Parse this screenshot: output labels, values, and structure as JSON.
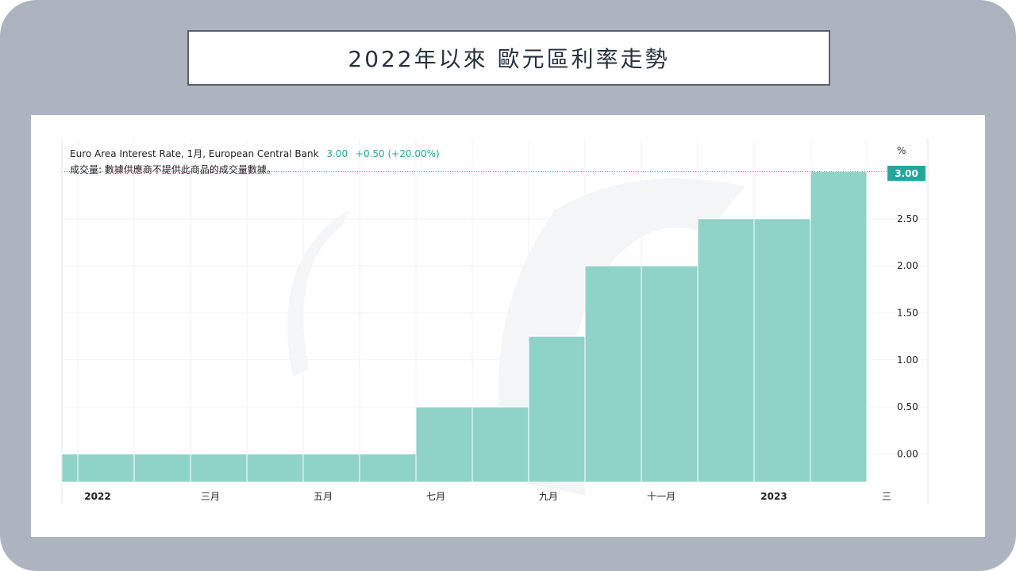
{
  "page": {
    "title": "2022年以來 歐元區利率走勢"
  },
  "legend": {
    "series_label": "Euro Area Interest Rate, 1月, European Central Bank",
    "last_value": "3.00",
    "change": "+0.50 (+20.00%)",
    "volume_note": "成交量: 數據供應商不提供此商品的成交量數據。"
  },
  "colors": {
    "bar_fill": "#8fd3c8",
    "accent": "#26a69a",
    "frame": "#adb4bf"
  },
  "chart_data": {
    "type": "bar",
    "title": "",
    "unit": "%",
    "categories": [
      "2021-12",
      "2022-01",
      "2022-02",
      "2022-03",
      "2022-04",
      "2022-05",
      "2022-06",
      "2022-07",
      "2022-08",
      "2022-09",
      "2022-10",
      "2022-11",
      "2022-12",
      "2023-01",
      "2023-02"
    ],
    "values": [
      0.0,
      0.0,
      0.0,
      0.0,
      0.0,
      0.0,
      0.0,
      0.5,
      0.5,
      1.25,
      2.0,
      2.0,
      2.5,
      2.5,
      3.0
    ],
    "ylim": [
      -0.3,
      3.35
    ],
    "y_ticks": [
      "0.00",
      "0.50",
      "1.00",
      "1.50",
      "2.00",
      "2.50",
      "3.00"
    ],
    "x_ticks": [
      {
        "month_index": 1,
        "label": "2022",
        "bold": true
      },
      {
        "month_index": 3,
        "label": "三月",
        "bold": false
      },
      {
        "month_index": 5,
        "label": "五月",
        "bold": false
      },
      {
        "month_index": 7,
        "label": "七月",
        "bold": false
      },
      {
        "month_index": 9,
        "label": "九月",
        "bold": false
      },
      {
        "month_index": 11,
        "label": "十一月",
        "bold": false
      },
      {
        "month_index": 13,
        "label": "2023",
        "bold": true
      },
      {
        "month_index": 15,
        "label": "三",
        "bold": false
      }
    ],
    "last_price_label": "3.00",
    "grid": true
  }
}
